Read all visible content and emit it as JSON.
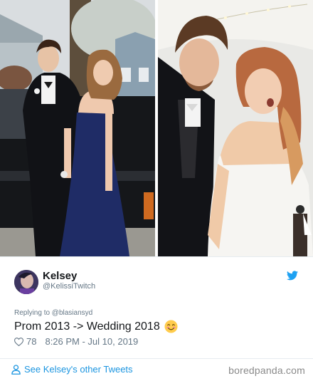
{
  "tweet": {
    "author_name": "Kelsey",
    "author_handle": "@KelissiTwitch",
    "reply_to": "Replying to @blasiansyd",
    "text": "Prom 2013 -> Wedding 2018",
    "emoji": "smiling-face-emoji",
    "like_count": "78",
    "timestamp": "8:26 PM - Jul 10, 2019",
    "see_more_label": "See Kelsey's other Tweets"
  },
  "watermark": "boredpanda.com",
  "icons": {
    "twitter": "twitter-bird-icon",
    "heart": "heart-icon",
    "person": "person-icon"
  },
  "colors": {
    "twitter_blue": "#1da1f2",
    "link_blue": "#1b95e0",
    "muted_text": "#657786",
    "divider": "#e6ecf0"
  }
}
